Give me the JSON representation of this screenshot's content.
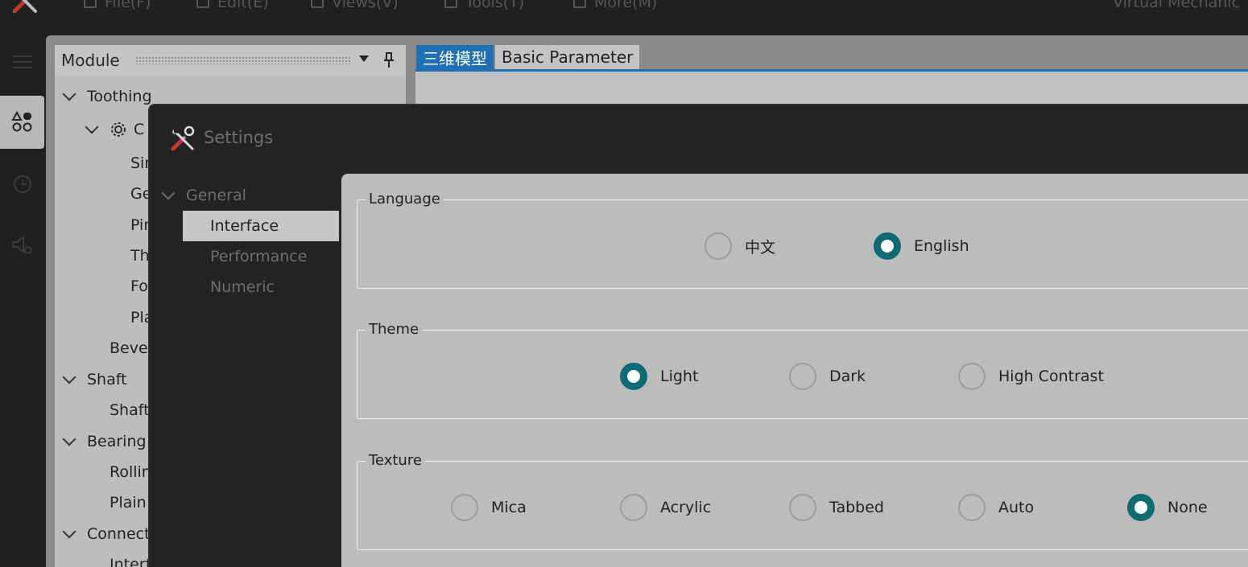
{
  "menu": {
    "items": [
      {
        "label": "File(F)"
      },
      {
        "label": "Edit(E)"
      },
      {
        "label": "Views(V)"
      },
      {
        "label": "Tools(T)"
      },
      {
        "label": "More(M)"
      }
    ],
    "app_title": "Virtual Mechanic"
  },
  "module_panel": {
    "title": "Module",
    "tree": [
      {
        "label": "Toothing"
      },
      {
        "label": "C"
      },
      {
        "label": "Sin"
      },
      {
        "label": "Ge"
      },
      {
        "label": "Pin"
      },
      {
        "label": "Th"
      },
      {
        "label": "Fo"
      },
      {
        "label": "Pla"
      },
      {
        "label": "Bevel"
      },
      {
        "label": "Shaft"
      },
      {
        "label": "Shaft"
      },
      {
        "label": "Bearing"
      },
      {
        "label": "Rollin"
      },
      {
        "label": "Plain"
      },
      {
        "label": "Connect"
      },
      {
        "label": "Interf"
      }
    ]
  },
  "doc_tabs": [
    {
      "label": "三维模型",
      "active": true
    },
    {
      "label": "Basic Parameter",
      "active": false
    }
  ],
  "settings": {
    "title": "Settings",
    "nav": {
      "group_label": "General",
      "items": [
        {
          "label": "Interface",
          "selected": true
        },
        {
          "label": "Performance",
          "selected": false
        },
        {
          "label": "Numeric",
          "selected": false
        }
      ]
    },
    "language": {
      "legend": "Language",
      "options": [
        {
          "label": "中文",
          "checked": false
        },
        {
          "label": "English",
          "checked": true
        }
      ]
    },
    "theme": {
      "legend": "Theme",
      "options": [
        {
          "label": "Light",
          "checked": true
        },
        {
          "label": "Dark",
          "checked": false
        },
        {
          "label": "High Contrast",
          "checked": false
        }
      ]
    },
    "texture": {
      "legend": "Texture",
      "options": [
        {
          "label": "Mica",
          "checked": false
        },
        {
          "label": "Acrylic",
          "checked": false
        },
        {
          "label": "Tabbed",
          "checked": false
        },
        {
          "label": "Auto",
          "checked": false
        },
        {
          "label": "None",
          "checked": true
        }
      ]
    }
  },
  "colors": {
    "accent_blue": "#1e6fb3",
    "radio_checked": "#0e6b73",
    "dialog_bg": "#232323",
    "content_bg": "#bcbcbc"
  }
}
